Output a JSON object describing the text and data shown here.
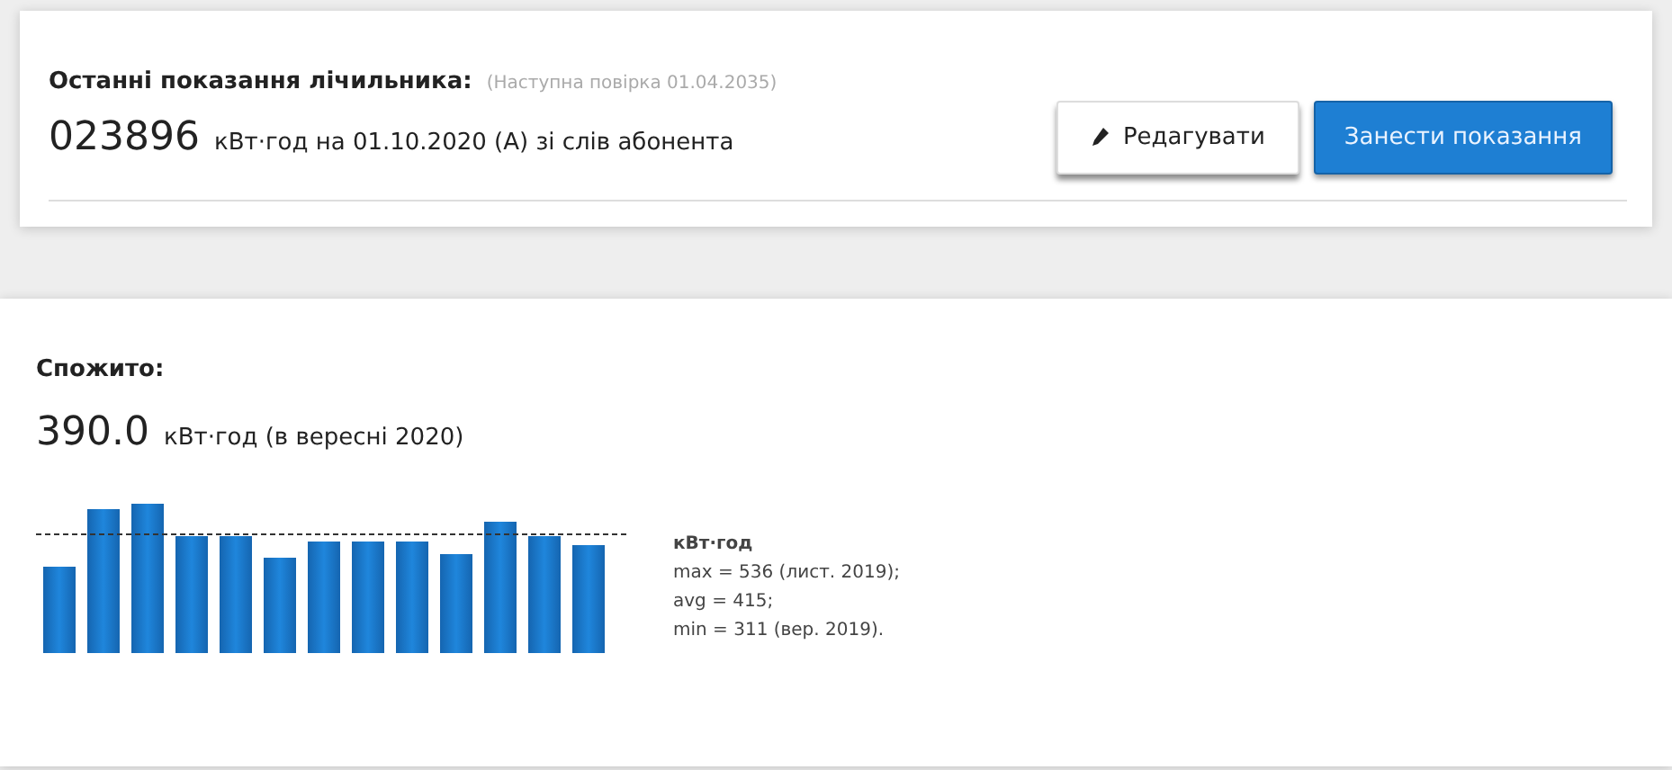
{
  "meter": {
    "title": "Останні показання лічильника:",
    "note": "(Наступна повірка 01.04.2035)",
    "reading": "023896",
    "reading_detail": "кВт·год на 01.10.2020 (А) зі слів абонента",
    "buttons": [
      {
        "kind": "edit",
        "label": "Редагувати"
      },
      {
        "kind": "submit",
        "label": "Занести показання"
      }
    ]
  },
  "consumption": {
    "title": "Спожито:",
    "amount": "390.0",
    "amount_detail": "кВт·год (в вересні 2020)",
    "legend": {
      "unit": "кВт·год",
      "lines": [
        "max = 536 (лист. 2019);",
        "avg = 415;",
        "min = 311 (вер. 2019)."
      ]
    }
  }
}
